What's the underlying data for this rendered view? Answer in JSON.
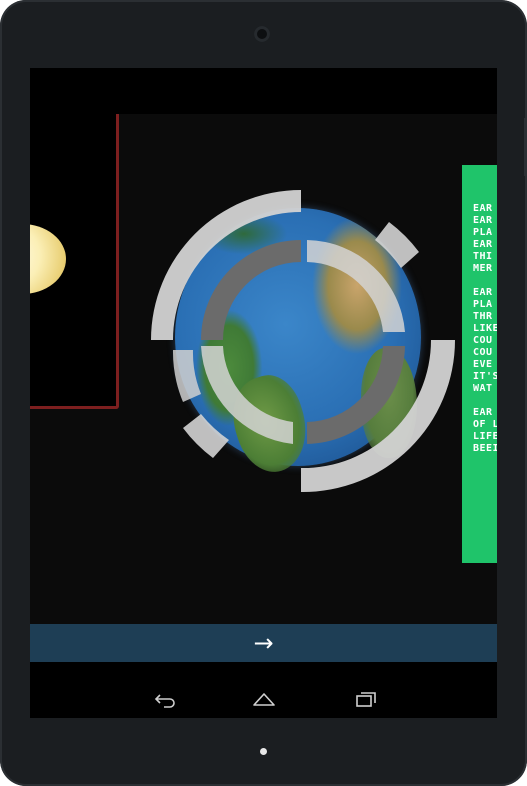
{
  "info_panel": {
    "background": "#1fc46a",
    "lines": [
      "EAR",
      "EAR",
      "PLA",
      "EAR",
      "THI",
      "MER",
      "",
      "EAR",
      "PLA",
      "THR",
      "LIKE",
      "COU",
      "COU",
      "EVE",
      "IT'S",
      "WAT",
      "",
      "EAR",
      "OF L",
      "LIFE",
      "BEEI"
    ]
  },
  "bottom_bar": {
    "background": "#1e3e55",
    "next_icon": "arrow-right-icon",
    "next_label": "→"
  },
  "nav_bar": {
    "back_icon": "back-icon",
    "home_icon": "home-icon",
    "recents_icon": "recents-icon"
  },
  "colors": {
    "sun_panel_border": "#7d1f1f",
    "ring_light": "#d3d3d3",
    "ring_dark": "#6b6b6b",
    "ocean": "#2a6fb4"
  }
}
